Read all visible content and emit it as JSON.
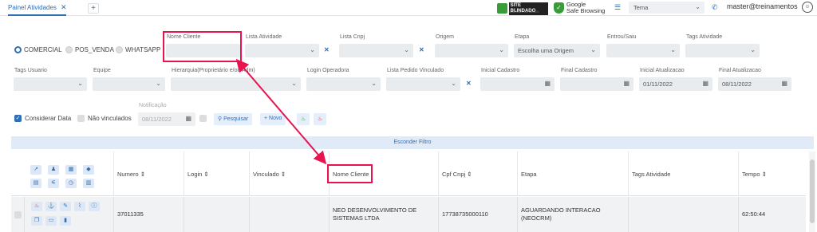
{
  "tab": {
    "label": "Painel Atividades",
    "close": "✕",
    "add": "+"
  },
  "header": {
    "site_blindado": "SITE BLINDADO",
    "site_blindado_sub": "AUDITADO EM 08-NOV",
    "google_line1": "Google",
    "google_line2": "Safe Browsing",
    "tema_placeholder": "Tema",
    "user": "master@treinamentos"
  },
  "filters": {
    "radios": [
      "COMERCIAL",
      "POS_VENDA",
      "WHATSAPP"
    ],
    "nome_cliente": "Nome Cliente",
    "lista_atividade": "Lista Atividade",
    "lista_cnpj": "Lista Cnpj",
    "origem": "Origem",
    "etapa": "Etapa",
    "etapa_value": "Escolha uma Origem",
    "entrou_saiu": "Entrou/Saiu",
    "tags_atividade": "Tags Atividade",
    "tags_usuario": "Tags Usuario",
    "equipe": "Equipe",
    "hierarquia": "Hierarquia(Proprietário e/ou Adm)",
    "login_operadora": "Login Operadora",
    "lista_pedido": "Lista Pedido Vinculado",
    "inicial_cadastro": "Inicial Cadastro",
    "final_cadastro": "Final Cadastro",
    "inicial_atualizacao": "Inicial Atualizacao",
    "inicial_atualizacao_value": "01/11/2022",
    "final_atualizacao": "Final Atualizacao",
    "final_atualizacao_value": "08/11/2022",
    "considerar_data": "Considerar Data",
    "nao_vinculados": "Não vinculados",
    "notificacao": "Notificação",
    "notificacao_value": "08/11/2022",
    "pesquisar": "Pesquisar",
    "novo": "Novo",
    "esconder": "Esconder Filtro"
  },
  "table": {
    "headers": [
      "Numero ⇕",
      "Login ⇕",
      "Vinculado ⇕",
      "Nome Cliente",
      "Cpf Cnpj ⇕",
      "Etapa",
      "Tags Atividade",
      "Tempo ⇕"
    ],
    "row": {
      "numero": "37011335",
      "login": "",
      "vinculado": "",
      "nome_cliente": "NEO DESENVOLVIMENTO DE SISTEMAS LTDA",
      "cpf": "17738735000110",
      "etapa": "AGUARDANDO INTERACAO (NEOCRM)",
      "tags": "",
      "tempo": "62:50:44"
    }
  },
  "colors": {
    "accent": "#2f6fb5",
    "highlight": "#e8134f"
  }
}
